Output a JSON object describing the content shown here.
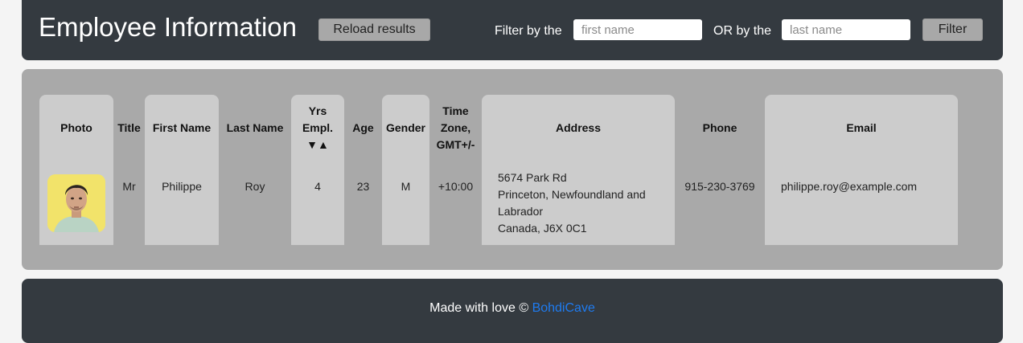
{
  "header": {
    "title": "Employee Information",
    "reload_label": "Reload results",
    "filter_label_1": "Filter by the",
    "first_name_placeholder": "first name",
    "filter_label_2": "OR by the",
    "last_name_placeholder": "last name",
    "filter_button_label": "Filter"
  },
  "table": {
    "columns": {
      "photo": "Photo",
      "title": "Title",
      "first_name": "First Name",
      "last_name": "Last Name",
      "years_employed": [
        "Yrs",
        "Empl.",
        "▼▲"
      ],
      "age": "Age",
      "gender": "Gender",
      "time_zone": [
        "Time",
        "Zone,",
        "GMT+/-"
      ],
      "address": "Address",
      "phone": "Phone",
      "email": "Email"
    },
    "rows": [
      {
        "photo_icon": "employee-portrait",
        "title": "Mr",
        "first_name": "Philippe",
        "last_name": "Roy",
        "years_employed": "4",
        "age": "23",
        "gender": "M",
        "time_zone": "+10:00",
        "address": [
          "5674 Park Rd",
          "Princeton, Newfoundland and",
          "Labrador",
          "Canada, J6X 0C1"
        ],
        "phone": "915-230-3769",
        "email": "philippe.roy@example.com"
      }
    ]
  },
  "footer": {
    "text": "Made with love ©",
    "link_label": "BohdiCave"
  },
  "colors": {
    "header_bg": "#343a40",
    "panel_bg": "#a9a9a9",
    "column_bg": "#cccccc",
    "link": "#1e7bf0"
  }
}
